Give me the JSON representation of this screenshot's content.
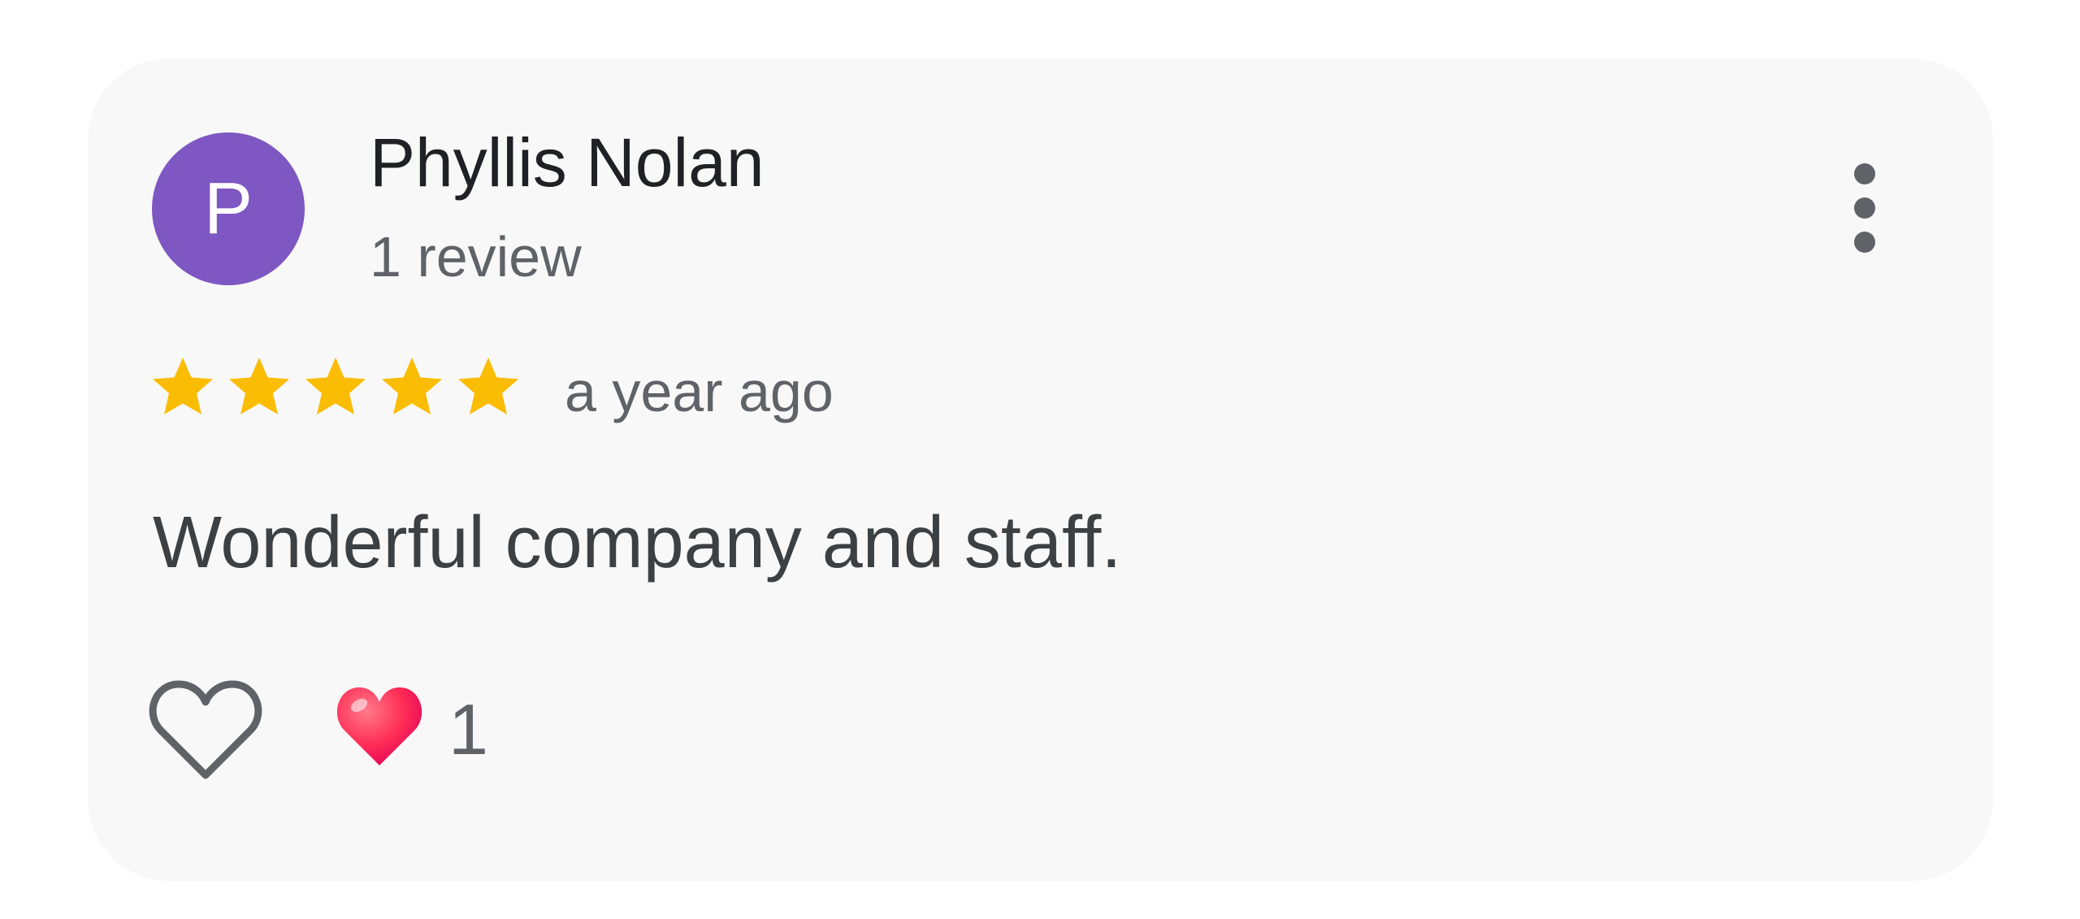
{
  "review": {
    "author_initial": "P",
    "author_name": "Phyllis Nolan",
    "review_count": "1 review",
    "rating": 5,
    "rating_max": 5,
    "time_ago": "a year ago",
    "text": "Wonderful company and staff.",
    "reaction_count": "1"
  },
  "colors": {
    "avatar_bg": "#7e57c2",
    "star": "#fbbc04",
    "card_bg": "#f8f8f8",
    "reaction_heart": "#ff2d55"
  },
  "icons": {
    "more": "more-vertical-icon",
    "star": "star-icon",
    "like": "heart-outline-icon",
    "reaction": "red-heart-emoji-icon"
  }
}
